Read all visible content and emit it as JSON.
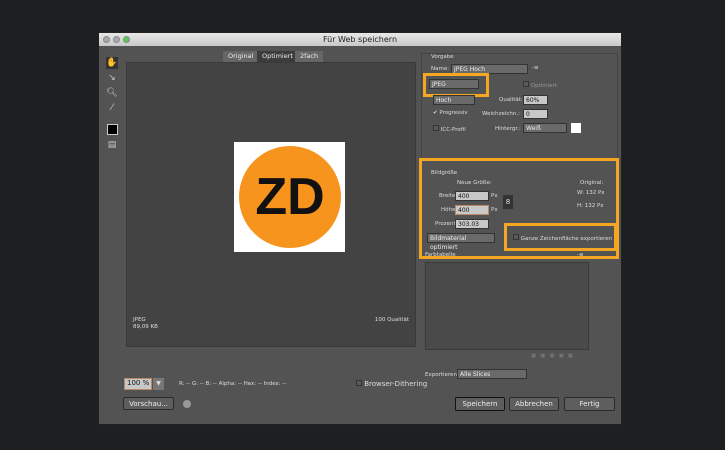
{
  "window": {
    "title": "Für Web speichern"
  },
  "tabs": [
    "Original",
    "Optimiert",
    "2fach"
  ],
  "tools": [
    "hand-icon",
    "slice-select-icon",
    "zoom-icon",
    "eyedropper-icon",
    "color-swatch",
    "toggle-slices-icon"
  ],
  "preview": {
    "logo_text": "ZD",
    "format": "JPEG",
    "size": "89,09 KB",
    "quality": "100 Qualität"
  },
  "bottom": {
    "zoom": "100 %",
    "readout": "R: --  G: --  B: --  Alpha: --  Hex: --  Index: --",
    "browser_dithering": "Browser-Dithering",
    "preview_button": "Vorschau..."
  },
  "settings": {
    "section": "Vorgabe",
    "name_label": "Name:",
    "name_value": "JPEG Hoch",
    "format": "JPEG",
    "optimized": "Optimiert",
    "compression": "Hoch",
    "quality_label": "Qualität:",
    "quality_value": "60%",
    "progressive": "Progressiv",
    "blur_label": "Weichzeichn.:",
    "blur_value": "0",
    "icc": "ICC-Profil",
    "matte_label": "Hintergr.:",
    "matte_value": "Weiß"
  },
  "image_size": {
    "section": "Bildgröße",
    "new_size": "Neue Größe:",
    "width_label": "Breite",
    "width": "400",
    "height_label": "Höhe",
    "height": "400",
    "unit": "Px",
    "percent_label": "Prozent",
    "percent": "303.03",
    "resample": "Bildmaterial optimiert",
    "original": "Original:",
    "orig_w": "W:  132  Px",
    "orig_h": "H:  132  Px",
    "export_artboard": "Ganze Zeichenfläche exportieren"
  },
  "color_table": {
    "section": "Farbtabelle"
  },
  "export": {
    "label": "Exportieren:",
    "value": "Alle Slices"
  },
  "buttons": {
    "save": "Speichern",
    "cancel": "Abbrechen",
    "done": "Fertig"
  },
  "colors": {
    "highlight": "#f5a623",
    "logo_orange": "#f7941d"
  }
}
